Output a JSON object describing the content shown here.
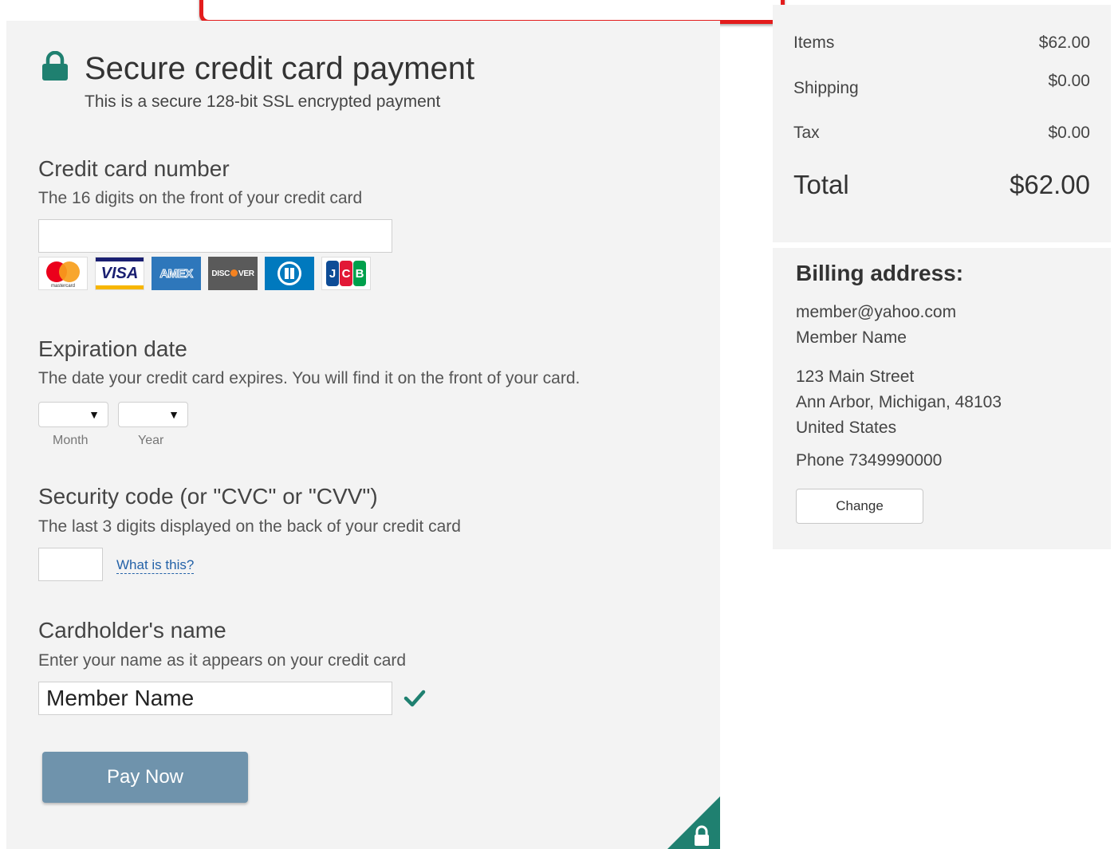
{
  "header": {
    "title": "Secure credit card payment",
    "subtitle": "This is a secure 128-bit SSL encrypted payment"
  },
  "card_number": {
    "title": "Credit card number",
    "description": "The 16 digits on the front of your credit card",
    "value": "",
    "logos": [
      {
        "name": "mastercard",
        "text": "mastercard"
      },
      {
        "name": "visa",
        "text": "VISA"
      },
      {
        "name": "amex",
        "text": "AMEX"
      },
      {
        "name": "discover",
        "text_a": "DISC",
        "text_b": "VER"
      },
      {
        "name": "diners-club",
        "text": ""
      },
      {
        "name": "jcb",
        "letters": [
          "J",
          "C",
          "B"
        ]
      }
    ]
  },
  "expiration": {
    "title": "Expiration date",
    "description": "The date your credit card expires. You will find it on the front of your card.",
    "month_label": "Month",
    "year_label": "Year",
    "month_value": "",
    "year_value": "",
    "arrow": "▼"
  },
  "security_code": {
    "title": "Security code (or \"CVC\" or \"CVV\")",
    "description": "The last 3 digits displayed on the back of your credit card",
    "value": "",
    "help_link": "What is this?"
  },
  "cardholder": {
    "title": "Cardholder's name",
    "description": "Enter your name as it appears on your credit card",
    "value": "Member Name",
    "valid": true
  },
  "pay_button": {
    "label": "Pay Now"
  },
  "summary": {
    "items_label": "Items",
    "items_value": "$62.00",
    "shipping_label": "Shipping",
    "shipping_value": "$0.00",
    "tax_label": "Tax",
    "tax_value": "$0.00",
    "total_label": "Total",
    "total_value": "$62.00"
  },
  "billing": {
    "title": "Billing address:",
    "email": "member@yahoo.com",
    "name": "Member Name",
    "street": "123 Main Street",
    "city_line": "Ann Arbor, Michigan, 48103",
    "country": "United States",
    "phone": "Phone 7349990000",
    "change_label": "Change"
  },
  "colors": {
    "accent_green": "#1f8070",
    "pay_button": "#6f93ac",
    "panel_bg": "#f3f3f3",
    "callout_red": "#e31c1c",
    "link_blue": "#2462a8"
  },
  "icons": {
    "lock": "padlock",
    "check": "checkmark",
    "corner": "padlock-badge"
  }
}
